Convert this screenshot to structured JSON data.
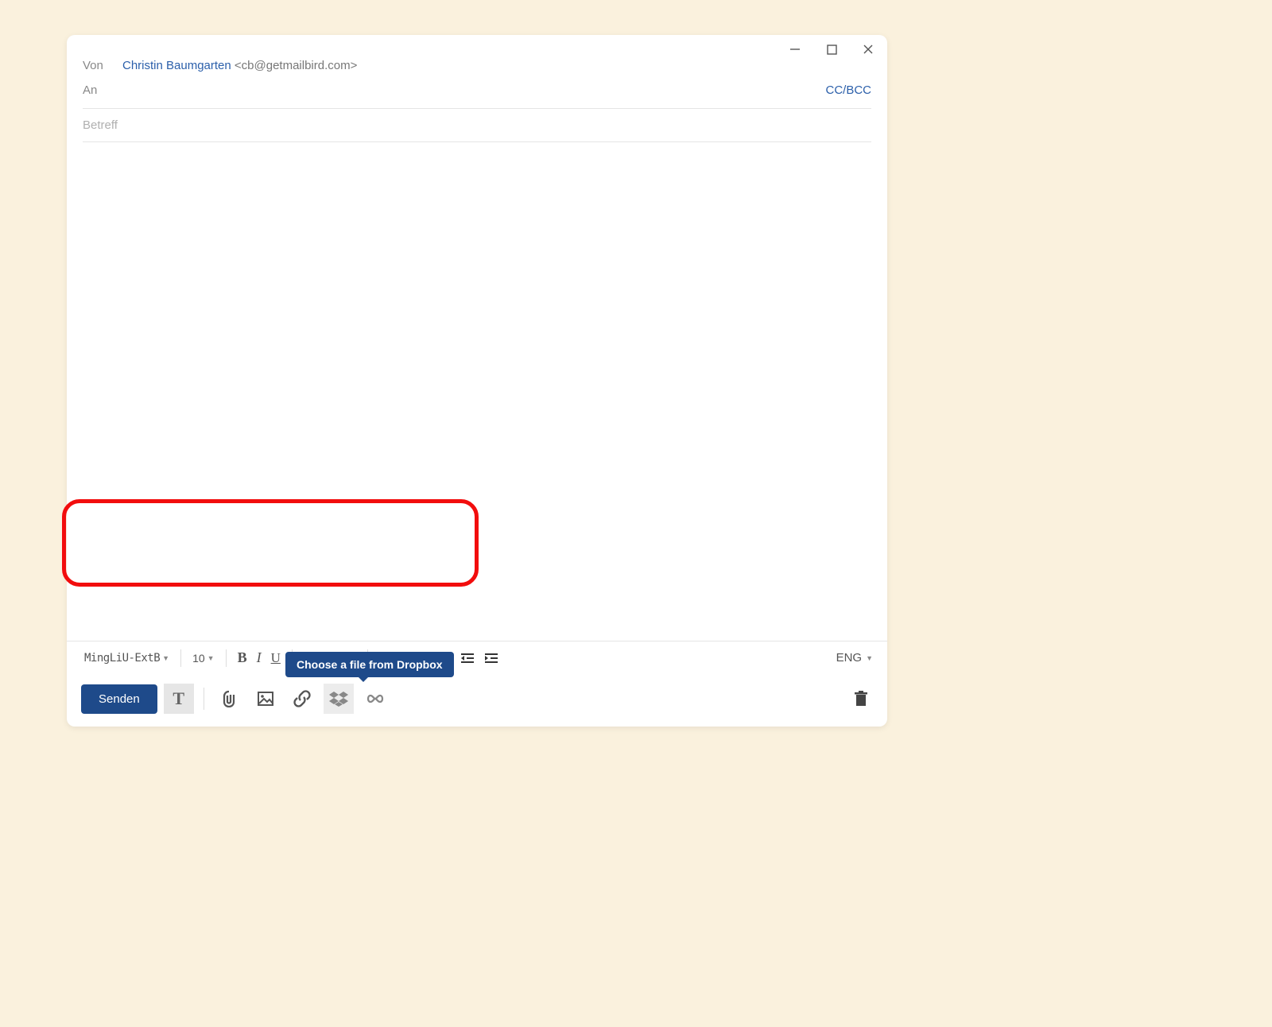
{
  "fields": {
    "from_label": "Von",
    "from_name": "Christin Baumgarten",
    "from_email": "<cb@getmailbird.com>",
    "to_label": "An",
    "ccbcc_label": "CC/BCC",
    "subject_placeholder": "Betreff"
  },
  "format_toolbar": {
    "font_name": "MingLiU-ExtB",
    "font_size": "10",
    "bold": "B",
    "italic": "I",
    "underline": "U",
    "language": "ENG"
  },
  "actions": {
    "send_label": "Senden"
  },
  "tooltip": {
    "dropbox": "Choose a file from Dropbox"
  }
}
